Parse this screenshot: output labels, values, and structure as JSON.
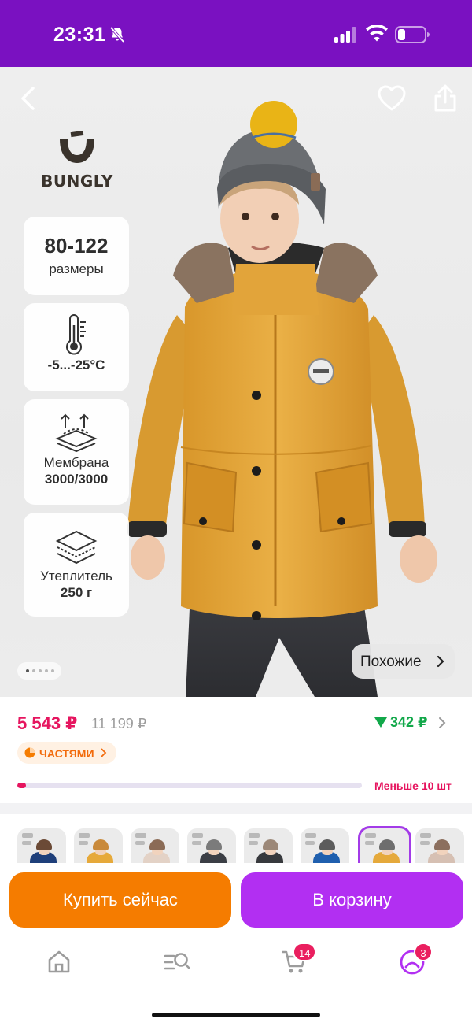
{
  "status_bar": {
    "time": "23:31"
  },
  "brand": {
    "name": "BUNGLY"
  },
  "features": [
    {
      "title": "80-122",
      "subtitle": "размеры"
    },
    {
      "title": "-5...-25°C",
      "icon": "thermometer-icon"
    },
    {
      "title": "Мембрана",
      "subtitle": "3000/3000",
      "icon": "membrane-icon"
    },
    {
      "title": "Утеплитель",
      "subtitle": "250 г",
      "icon": "insulation-layers-icon"
    }
  ],
  "similar_button": {
    "label": "Похожие"
  },
  "price": {
    "current": "5 543 ₽",
    "old": "11 199 ₽",
    "cashback": "342 ₽",
    "installments_label": "ЧАСТЯМИ",
    "stock_text": "Меньше 10 шт",
    "stock_fraction": 0.025
  },
  "variants": [
    {
      "color": "#1e3f7a",
      "hat": "#6b4a36"
    },
    {
      "color": "#e6a93a",
      "hat": "#c98a3b"
    },
    {
      "color": "#e3d2c6",
      "hat": "#8b6b56"
    },
    {
      "color": "#3b3e45",
      "hat": "#7b7b7b"
    },
    {
      "color": "#37393d",
      "hat": "#9c8878"
    },
    {
      "color": "#1f5fae",
      "hat": "#5c5c5c"
    },
    {
      "color": "#e5a93b",
      "hat": "#6e6e6e",
      "selected": true
    },
    {
      "color": "#d6c0b3",
      "hat": "#8c6f5e"
    }
  ],
  "actions": {
    "buy_now": "Купить сейчас",
    "add_to_cart": "В корзину"
  },
  "tab_bar": {
    "cart_badge": "14",
    "profile_badge": "3"
  },
  "colors": {
    "status_bar": "#7a11c1",
    "price": "#e6155f",
    "cashback": "#12a84a",
    "buy_now": "#f57c00",
    "add_to_cart": "#b22ff2"
  }
}
